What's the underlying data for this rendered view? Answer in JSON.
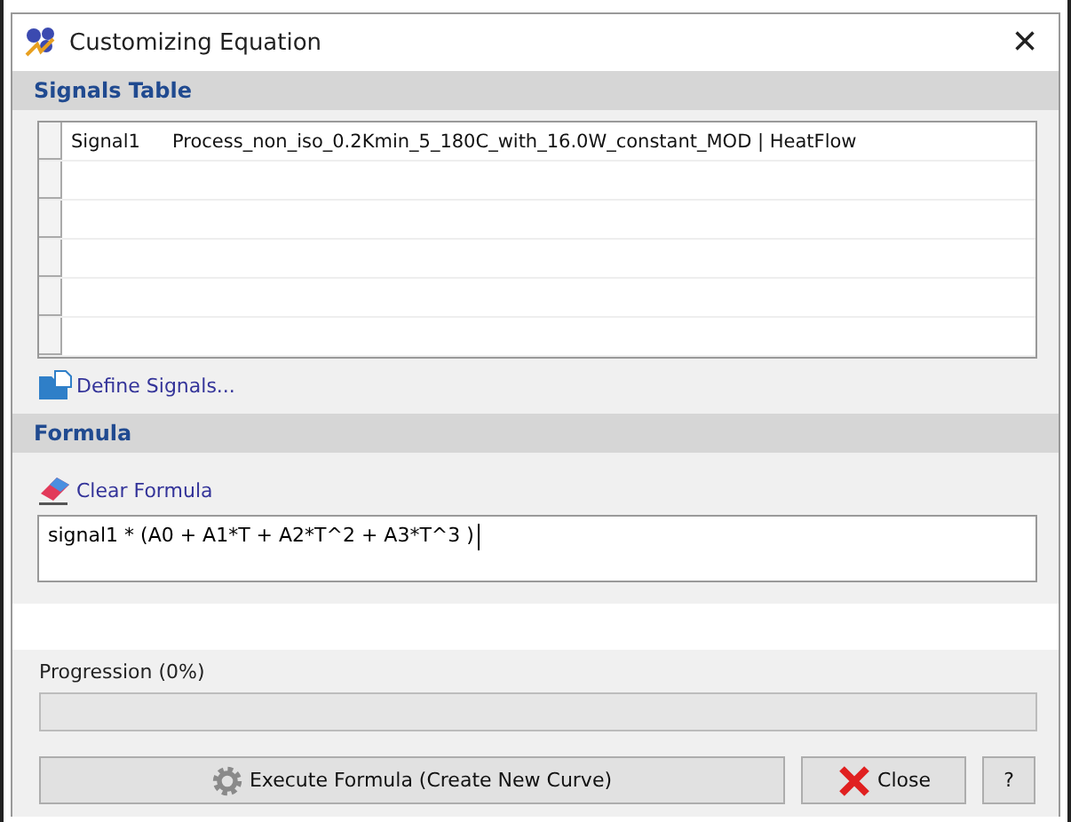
{
  "window": {
    "title": "Customizing Equation",
    "close": "×"
  },
  "signals_table": {
    "header": "Signals Table",
    "rows": [
      {
        "cells": [
          "Signal1",
          "Process_non_iso_0.2Kmin_5_180C_with_16.0W_constant_MOD | HeatFlow"
        ]
      }
    ],
    "action": "Define Signals..."
  },
  "formula": {
    "header": "Formula",
    "action": "Clear Formula",
    "value": "signal1 * (A0 + A1*T + A2*T^2 + A3*T^3 )"
  },
  "progress": {
    "label": "Progression (0%)",
    "level": 0
  },
  "buttons": [
    {
      "kind": "execute",
      "label": "Execute Formula (Create New Curve)"
    },
    {
      "kind": "close",
      "label": "Close"
    },
    {
      "kind": "help",
      "label": "?"
    }
  ]
}
